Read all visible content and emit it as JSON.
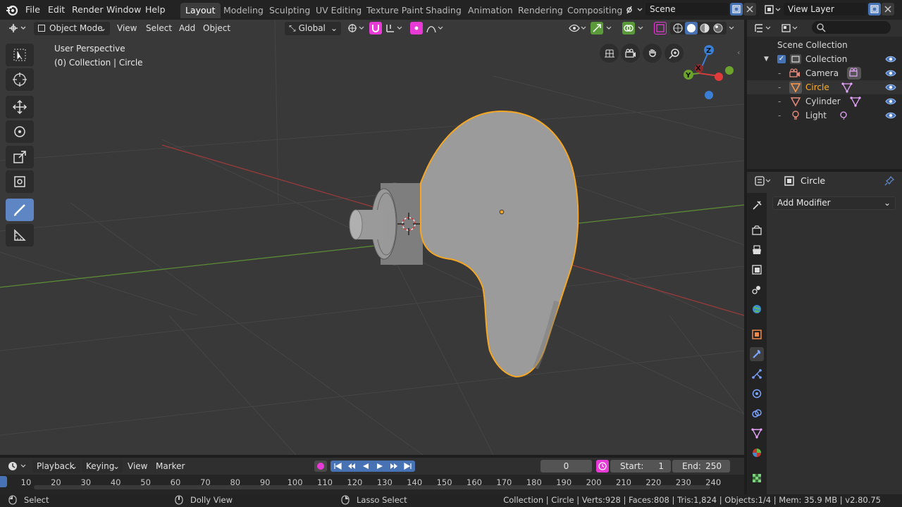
{
  "menu": {
    "items": [
      "File",
      "Edit",
      "Render",
      "Window",
      "Help"
    ]
  },
  "workspaces": [
    "Layout",
    "Modeling",
    "Sculpting",
    "UV Editing",
    "Texture Paint",
    "Shading",
    "Animation",
    "Rendering",
    "Compositing"
  ],
  "scene": {
    "label": "Scene"
  },
  "view_layer": {
    "label": "View Layer"
  },
  "viewport_header": {
    "mode": "Object Mode",
    "view": "View",
    "select": "Select",
    "add": "Add",
    "object": "Object",
    "orientation": "Global"
  },
  "viewport": {
    "perspective": "User Perspective",
    "collection_info": "(0) Collection | Circle",
    "gizmo_axes": [
      "X",
      "Y",
      "Z"
    ]
  },
  "outliner": {
    "root": "Scene Collection",
    "collection": "Collection",
    "items": [
      {
        "name": "Camera",
        "selected": false
      },
      {
        "name": "Circle",
        "selected": true
      },
      {
        "name": "Cylinder",
        "selected": false
      },
      {
        "name": "Light",
        "selected": false
      }
    ]
  },
  "properties": {
    "object_name": "Circle",
    "add_modifier": "Add Modifier"
  },
  "timeline": {
    "playback": "Playback",
    "keying": "Keying",
    "view": "View",
    "marker": "Marker",
    "current_frame": "0",
    "start_label": "Start:",
    "start": "1",
    "end_label": "End:",
    "end": "250",
    "ticks": [
      "10",
      "20",
      "30",
      "40",
      "50",
      "60",
      "70",
      "80",
      "90",
      "100",
      "110",
      "120",
      "130",
      "140",
      "150",
      "160",
      "170",
      "180",
      "190",
      "200",
      "210",
      "220",
      "230",
      "240"
    ]
  },
  "status": {
    "select": "Select",
    "dolly": "Dolly View",
    "lasso": "Lasso Select",
    "stats": "Collection | Circle | Verts:928 | Faces:808 | Tris:1,824 | Objects:1/4 | Mem: 35.9 MB | v2.80.75"
  },
  "colors": {
    "accent": "#4772b3",
    "selection_orange": "#f5a623",
    "active_object": "#ffaf29",
    "x_axis": "#d13d3d",
    "y_axis": "#6ba32d",
    "z_axis": "#3a7fd5",
    "magnet_pink": "#e83ad7"
  }
}
